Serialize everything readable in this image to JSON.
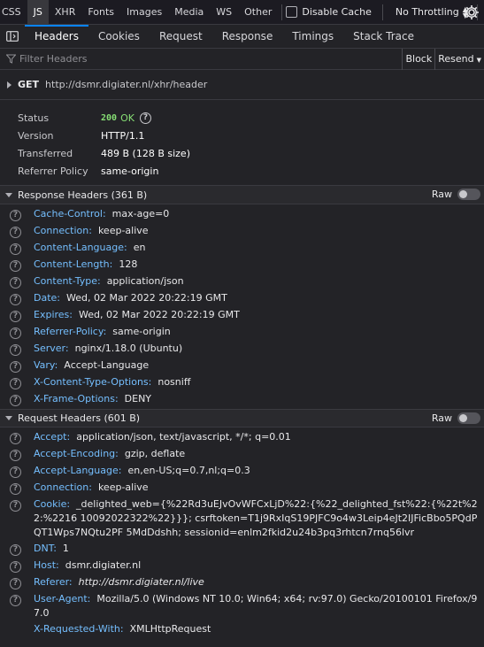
{
  "toolbar": {
    "filter_tabs": [
      "CSS",
      "JS",
      "XHR",
      "Fonts",
      "Images",
      "Media",
      "WS",
      "Other"
    ],
    "selected_tab_index": 1,
    "disable_cache_label": "Disable Cache",
    "throttling_label": "No Throttling"
  },
  "detail_tabs": [
    "Headers",
    "Cookies",
    "Request",
    "Response",
    "Timings",
    "Stack Trace"
  ],
  "filter": {
    "placeholder": "Filter Headers",
    "block_label": "Block",
    "resend_label": "Resend"
  },
  "request": {
    "method": "GET",
    "url": "http://dsmr.digiater.nl/xhr/header"
  },
  "summary": {
    "status_label": "Status",
    "status_code": "200",
    "status_text": "OK",
    "version_label": "Version",
    "version": "HTTP/1.1",
    "transferred_label": "Transferred",
    "transferred": "489 B (128 B size)",
    "referrer_policy_label": "Referrer Policy",
    "referrer_policy": "same-origin"
  },
  "response_headers": {
    "title": "Response Headers (361 B)",
    "raw_label": "Raw",
    "items": [
      {
        "name": "Cache-Control:",
        "value": "max-age=0"
      },
      {
        "name": "Connection:",
        "value": "keep-alive"
      },
      {
        "name": "Content-Language:",
        "value": "en"
      },
      {
        "name": "Content-Length:",
        "value": "128"
      },
      {
        "name": "Content-Type:",
        "value": "application/json"
      },
      {
        "name": "Date:",
        "value": "Wed, 02 Mar 2022 20:22:19 GMT"
      },
      {
        "name": "Expires:",
        "value": "Wed, 02 Mar 2022 20:22:19 GMT"
      },
      {
        "name": "Referrer-Policy:",
        "value": "same-origin"
      },
      {
        "name": "Server:",
        "value": "nginx/1.18.0 (Ubuntu)"
      },
      {
        "name": "Vary:",
        "value": "Accept-Language"
      },
      {
        "name": "X-Content-Type-Options:",
        "value": "nosniff"
      },
      {
        "name": "X-Frame-Options:",
        "value": "DENY"
      }
    ]
  },
  "request_headers": {
    "title": "Request Headers (601 B)",
    "raw_label": "Raw",
    "items": [
      {
        "name": "Accept:",
        "value": "application/json, text/javascript, */*; q=0.01"
      },
      {
        "name": "Accept-Encoding:",
        "value": "gzip, deflate"
      },
      {
        "name": "Accept-Language:",
        "value": "en,en-US;q=0.7,nl;q=0.3"
      },
      {
        "name": "Connection:",
        "value": "keep-alive"
      },
      {
        "name": "Cookie:",
        "value": "_delighted_web={%22Rd3uEJvOvWFCxLjD%22:{%22_delighted_fst%22:{%22t%22:%2216 10092022322%22}}}; csrftoken=T1j9RxIqS19PJFC9o4w3Leip4eJt2IJFicBbo5PQdPQT1Wps7NQtu2PF 5MdDdshh; sessionid=enlm2fkid2u24b3pq3rhtcn7rnq56lvr"
      },
      {
        "name": "DNT:",
        "value": "1"
      },
      {
        "name": "Host:",
        "value": "dsmr.digiater.nl"
      },
      {
        "name": "Referer:",
        "value": "http://dsmr.digiater.nl/live",
        "italic": true
      },
      {
        "name": "User-Agent:",
        "value": "Mozilla/5.0 (Windows NT 10.0; Win64; x64; rv:97.0) Gecko/20100101 Firefox/97.0"
      },
      {
        "name": "X-Requested-With:",
        "value": "XMLHttpRequest",
        "no_help": true
      }
    ]
  },
  "icons": {
    "sidebar": "sidebar-toggle-icon",
    "filter": "funnel-icon",
    "settings": "gear-icon",
    "help": "question-circle-icon"
  }
}
